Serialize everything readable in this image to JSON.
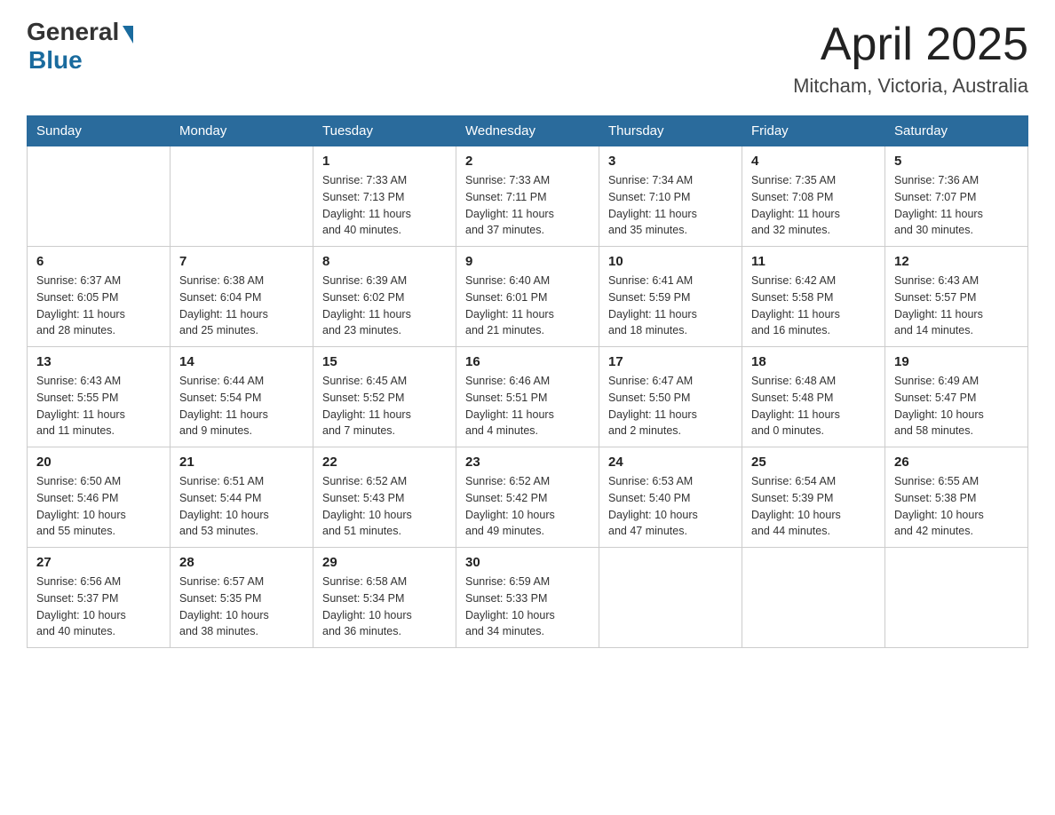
{
  "header": {
    "logo_general": "General",
    "logo_blue": "Blue",
    "title": "April 2025",
    "location": "Mitcham, Victoria, Australia"
  },
  "days_of_week": [
    "Sunday",
    "Monday",
    "Tuesday",
    "Wednesday",
    "Thursday",
    "Friday",
    "Saturday"
  ],
  "weeks": [
    [
      {
        "day": "",
        "info": ""
      },
      {
        "day": "",
        "info": ""
      },
      {
        "day": "1",
        "info": "Sunrise: 7:33 AM\nSunset: 7:13 PM\nDaylight: 11 hours\nand 40 minutes."
      },
      {
        "day": "2",
        "info": "Sunrise: 7:33 AM\nSunset: 7:11 PM\nDaylight: 11 hours\nand 37 minutes."
      },
      {
        "day": "3",
        "info": "Sunrise: 7:34 AM\nSunset: 7:10 PM\nDaylight: 11 hours\nand 35 minutes."
      },
      {
        "day": "4",
        "info": "Sunrise: 7:35 AM\nSunset: 7:08 PM\nDaylight: 11 hours\nand 32 minutes."
      },
      {
        "day": "5",
        "info": "Sunrise: 7:36 AM\nSunset: 7:07 PM\nDaylight: 11 hours\nand 30 minutes."
      }
    ],
    [
      {
        "day": "6",
        "info": "Sunrise: 6:37 AM\nSunset: 6:05 PM\nDaylight: 11 hours\nand 28 minutes."
      },
      {
        "day": "7",
        "info": "Sunrise: 6:38 AM\nSunset: 6:04 PM\nDaylight: 11 hours\nand 25 minutes."
      },
      {
        "day": "8",
        "info": "Sunrise: 6:39 AM\nSunset: 6:02 PM\nDaylight: 11 hours\nand 23 minutes."
      },
      {
        "day": "9",
        "info": "Sunrise: 6:40 AM\nSunset: 6:01 PM\nDaylight: 11 hours\nand 21 minutes."
      },
      {
        "day": "10",
        "info": "Sunrise: 6:41 AM\nSunset: 5:59 PM\nDaylight: 11 hours\nand 18 minutes."
      },
      {
        "day": "11",
        "info": "Sunrise: 6:42 AM\nSunset: 5:58 PM\nDaylight: 11 hours\nand 16 minutes."
      },
      {
        "day": "12",
        "info": "Sunrise: 6:43 AM\nSunset: 5:57 PM\nDaylight: 11 hours\nand 14 minutes."
      }
    ],
    [
      {
        "day": "13",
        "info": "Sunrise: 6:43 AM\nSunset: 5:55 PM\nDaylight: 11 hours\nand 11 minutes."
      },
      {
        "day": "14",
        "info": "Sunrise: 6:44 AM\nSunset: 5:54 PM\nDaylight: 11 hours\nand 9 minutes."
      },
      {
        "day": "15",
        "info": "Sunrise: 6:45 AM\nSunset: 5:52 PM\nDaylight: 11 hours\nand 7 minutes."
      },
      {
        "day": "16",
        "info": "Sunrise: 6:46 AM\nSunset: 5:51 PM\nDaylight: 11 hours\nand 4 minutes."
      },
      {
        "day": "17",
        "info": "Sunrise: 6:47 AM\nSunset: 5:50 PM\nDaylight: 11 hours\nand 2 minutes."
      },
      {
        "day": "18",
        "info": "Sunrise: 6:48 AM\nSunset: 5:48 PM\nDaylight: 11 hours\nand 0 minutes."
      },
      {
        "day": "19",
        "info": "Sunrise: 6:49 AM\nSunset: 5:47 PM\nDaylight: 10 hours\nand 58 minutes."
      }
    ],
    [
      {
        "day": "20",
        "info": "Sunrise: 6:50 AM\nSunset: 5:46 PM\nDaylight: 10 hours\nand 55 minutes."
      },
      {
        "day": "21",
        "info": "Sunrise: 6:51 AM\nSunset: 5:44 PM\nDaylight: 10 hours\nand 53 minutes."
      },
      {
        "day": "22",
        "info": "Sunrise: 6:52 AM\nSunset: 5:43 PM\nDaylight: 10 hours\nand 51 minutes."
      },
      {
        "day": "23",
        "info": "Sunrise: 6:52 AM\nSunset: 5:42 PM\nDaylight: 10 hours\nand 49 minutes."
      },
      {
        "day": "24",
        "info": "Sunrise: 6:53 AM\nSunset: 5:40 PM\nDaylight: 10 hours\nand 47 minutes."
      },
      {
        "day": "25",
        "info": "Sunrise: 6:54 AM\nSunset: 5:39 PM\nDaylight: 10 hours\nand 44 minutes."
      },
      {
        "day": "26",
        "info": "Sunrise: 6:55 AM\nSunset: 5:38 PM\nDaylight: 10 hours\nand 42 minutes."
      }
    ],
    [
      {
        "day": "27",
        "info": "Sunrise: 6:56 AM\nSunset: 5:37 PM\nDaylight: 10 hours\nand 40 minutes."
      },
      {
        "day": "28",
        "info": "Sunrise: 6:57 AM\nSunset: 5:35 PM\nDaylight: 10 hours\nand 38 minutes."
      },
      {
        "day": "29",
        "info": "Sunrise: 6:58 AM\nSunset: 5:34 PM\nDaylight: 10 hours\nand 36 minutes."
      },
      {
        "day": "30",
        "info": "Sunrise: 6:59 AM\nSunset: 5:33 PM\nDaylight: 10 hours\nand 34 minutes."
      },
      {
        "day": "",
        "info": ""
      },
      {
        "day": "",
        "info": ""
      },
      {
        "day": "",
        "info": ""
      }
    ]
  ]
}
